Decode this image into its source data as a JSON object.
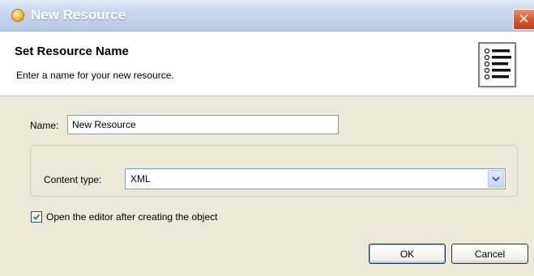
{
  "window": {
    "title": "New Resource",
    "close_glyph": "✕",
    "app_icon": "resource-icon"
  },
  "banner": {
    "title": "Set Resource Name",
    "description": "Enter a name for your new resource.",
    "graphic_icon": "document-list-icon"
  },
  "form": {
    "name_label": "Name:",
    "name_value": "New Resource",
    "content_type_label": "Content type:",
    "content_type_value": "XML",
    "open_editor_label": "Open the editor after creating the object",
    "open_editor_checked": true
  },
  "buttons": {
    "ok": "OK",
    "cancel": "Cancel"
  },
  "colors": {
    "dialog_bg": "#ece9d8",
    "titlebar_text": "#ffffff",
    "close_bg": "#d8572f",
    "input_border": "#7f9db9",
    "check_color": "#21a121"
  }
}
